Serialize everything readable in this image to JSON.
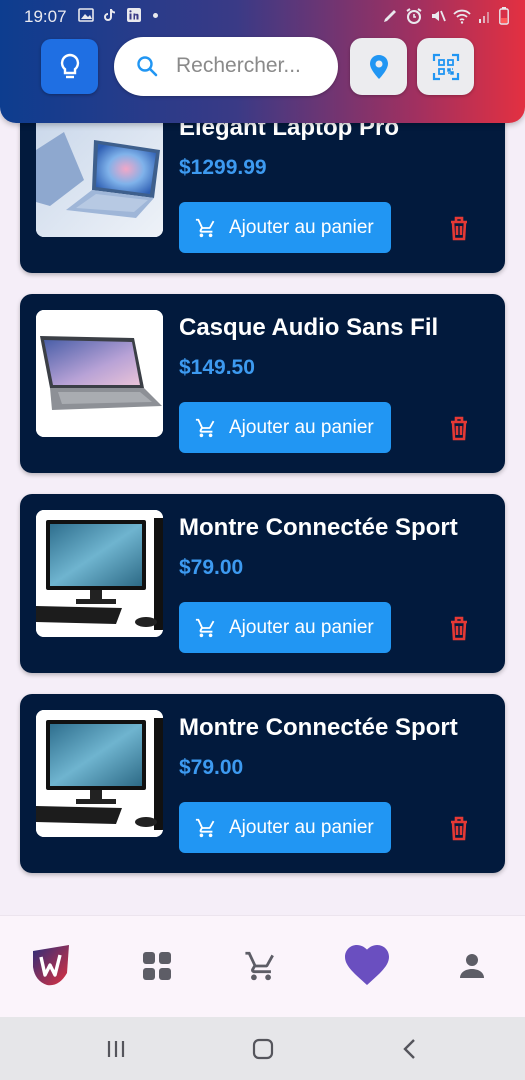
{
  "status_bar": {
    "time": "19:07"
  },
  "header": {
    "idea_icon": "lightbulb-icon",
    "search": {
      "placeholder": "Rechercher..."
    },
    "location_icon": "location-pin-icon",
    "qr_icon": "qr-scan-icon"
  },
  "colors": {
    "card_bg": "#021a3d",
    "price": "#3d9af0",
    "button": "#2196f3",
    "delete": "#e53935",
    "favorite": "#6a4fc0"
  },
  "products": [
    {
      "title": "Elegant Laptop Pro",
      "price": "$1299.99",
      "cart_label": "Ajouter au panier"
    },
    {
      "title": "Casque Audio Sans Fil",
      "price": "$149.50",
      "cart_label": "Ajouter au panier"
    },
    {
      "title": "Montre Connectée Sport",
      "price": "$79.00",
      "cart_label": "Ajouter au panier"
    },
    {
      "title": "Montre Connectée Sport",
      "price": "$79.00",
      "cart_label": "Ajouter au panier"
    }
  ],
  "bottom_nav": {
    "items": [
      "logo-icon",
      "grid-icon",
      "cart-icon",
      "heart-icon",
      "person-icon"
    ],
    "active": "heart-icon"
  },
  "system_nav": [
    "recents-icon",
    "home-icon",
    "back-icon"
  ]
}
